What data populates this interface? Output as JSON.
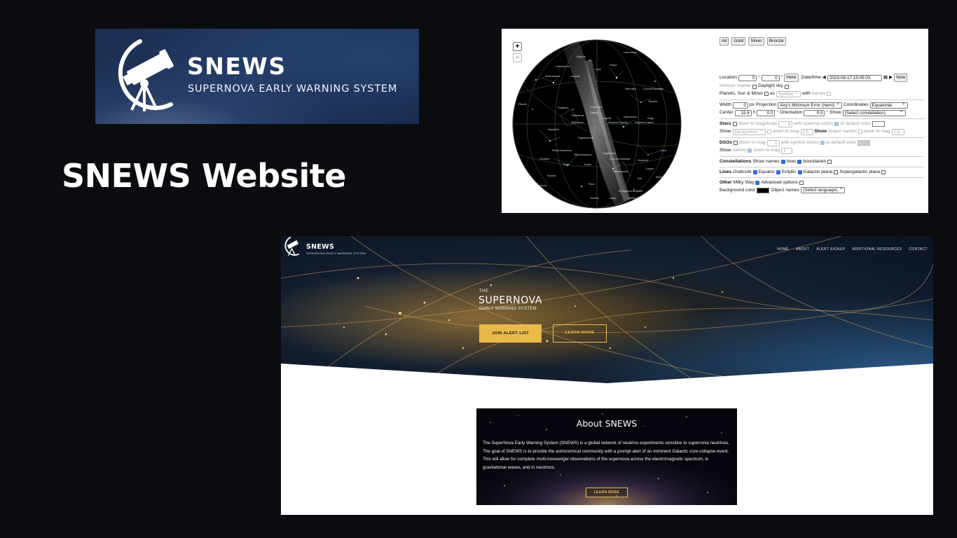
{
  "slide": {
    "title": "SNEWS Website"
  },
  "logo": {
    "brand": "SNEWS",
    "tagline": "SUPERNOVA EARLY WARNING SYSTEM",
    "icon": "telescope-icon"
  },
  "skymap": {
    "zoom_in": "+",
    "zoom_out": "−",
    "tabs": [
      "All",
      "Gold",
      "Silver",
      "Bronze"
    ],
    "location_label": "Location",
    "lat_value": "0",
    "lon_value": "0",
    "deg": "°",
    "here_label": "Here",
    "datetime_label": "Date/time",
    "datetime_value": "2023-08-17 15:05:03",
    "now_label": "Now",
    "horizon_label": "Horizon marker",
    "daylight_label": "Daylight sky",
    "planets_label": "Planets, Sun & Moon",
    "as_label": "as",
    "symbol_value": "Symbol",
    "with_label": "with",
    "names_label": "names",
    "width_label": "Width",
    "width_value": "0",
    "px_label": "px",
    "projection_label": "Projection",
    "projection_value": "Airy's Minimum Error (hemi)",
    "coordinates_label": "Coordinates",
    "coordinates_value": "Equatorial",
    "center_label": "Center",
    "center_h_value": "19.8",
    "h_label": "h",
    "center_deg_value": "0.0",
    "orientation_label": "Orientation",
    "orientation_value": "0.0",
    "show_label": "Show",
    "constellation_select": "(Select constellation)",
    "stars_label": "Stars",
    "down_to_magnitude_label": "down to magnitude",
    "stars_mag_value": "6",
    "spectral_label": "with spectral colors",
    "default_color_label": "or default color",
    "designation_value": "Designation",
    "down_to_mag_label": "down to mag",
    "desig_mag_value": "2.5",
    "proper_names_label": "proper names",
    "proper_mag_value": "1.5",
    "dsos_label": "DSOs",
    "dso_mag_value": "6",
    "symbol_colors_label": "with symbol colors",
    "dso_names_mag_value": "4",
    "constellations_label": "Constellations",
    "lines_label": "lines",
    "boundaries_label": "boundaries",
    "lines_section_label": "Lines",
    "graticule_label": "Graticule",
    "equator_label": "Equator",
    "ecliptic_label": "Ecliptic",
    "galactic_plane_label": "Galactic plane",
    "supergalactic_plane_label": "Supergalactic plane",
    "other_label": "Other",
    "milky_way_label": "Milky Way",
    "advanced_label": "Advanced options",
    "background_color_label": "Background color",
    "object_names_label": "Object names",
    "language_select": "(Select language)",
    "constellation_names": [
      "Cassiopeia",
      "Andromeda",
      "Lacerta",
      "Cygnus",
      "Lyra",
      "Draco",
      "Ursa Minor",
      "Hercules",
      "Corona Borealis",
      "Bootes",
      "Pisces",
      "Pegasus",
      "Vulpecula",
      "Sagitta",
      "Delphinus",
      "Aquila",
      "Serpens Cauda",
      "Ophiuchus",
      "Serpens Caput",
      "Virgo",
      "Equuleus",
      "Aquarius",
      "Capricornus",
      "Piscis Austrinus",
      "Microscopium",
      "Sagittarius",
      "Corona Australis",
      "Scorpius",
      "Libra",
      "Lupus",
      "Sculptor",
      "Grus",
      "Indus",
      "Telescopium",
      "Ara",
      "Norma",
      "Pavo",
      "Triangulum Australe",
      "Tucana",
      "Phoenix",
      "Octans",
      "Apus",
      "Circinus"
    ]
  },
  "website": {
    "brand": "SNEWS",
    "tagline": "SUPERNOVA EARLY WARNING SYSTEM",
    "nav": [
      "HOME",
      "ABOUT",
      "ALERT SIGNUP",
      "ADDITIONAL RESOURCES",
      "CONTACT"
    ],
    "hero_the": "THE",
    "hero_title": "SUPERNOVA",
    "hero_subtitle": "EARLY WARNING SYSTEM",
    "join_button": "JOIN ALERT LIST",
    "learn_button": "LEARN MORE",
    "about_title": "About SNEWS",
    "about_text": "The SuperNova Early Warning System (SNEWS) is a global network of neutrino experiments sensitive to supernova neutrinos.  The goal of SNEWS is to provide the astronomical community with a prompt alert of an imminent  Galactic core-collapse event. This will allow for complete multi-messenger observations of the supernova across the electromagnetic spectrum, in gravitational waves, and in neutrinos.",
    "about_button": "LEARN MORE"
  },
  "colors": {
    "background": "#0b0c10",
    "accent_gold": "#e9b949",
    "banner_blue": "#1b2d50"
  }
}
